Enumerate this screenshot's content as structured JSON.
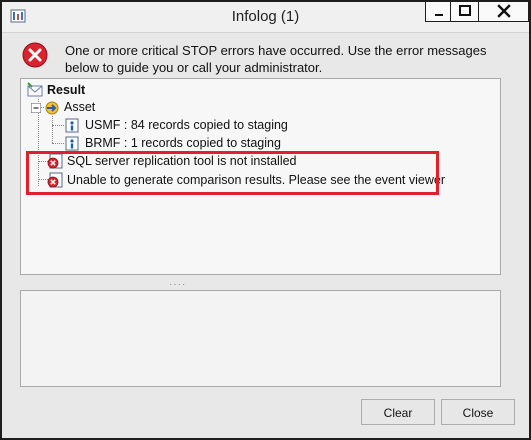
{
  "window": {
    "title": "Infolog (1)"
  },
  "message": {
    "text": "One or more critical STOP errors have occurred. Use the error messages below to guide you or call your administrator."
  },
  "tree": {
    "root_label": "Result",
    "group_label": "Asset",
    "info_items": [
      "USMF : 84 records copied to staging",
      "BRMF : 1 records copied to staging"
    ],
    "error_items": [
      "SQL server replication tool is not installed",
      "Unable to generate comparison results. Please see the event viewer"
    ]
  },
  "buttons": {
    "clear_label": "Clear",
    "close_label": "Close"
  },
  "colors": {
    "highlight": "#e0202e",
    "error_icon": "#d9232e",
    "info_icon": "#1f5fa8"
  }
}
